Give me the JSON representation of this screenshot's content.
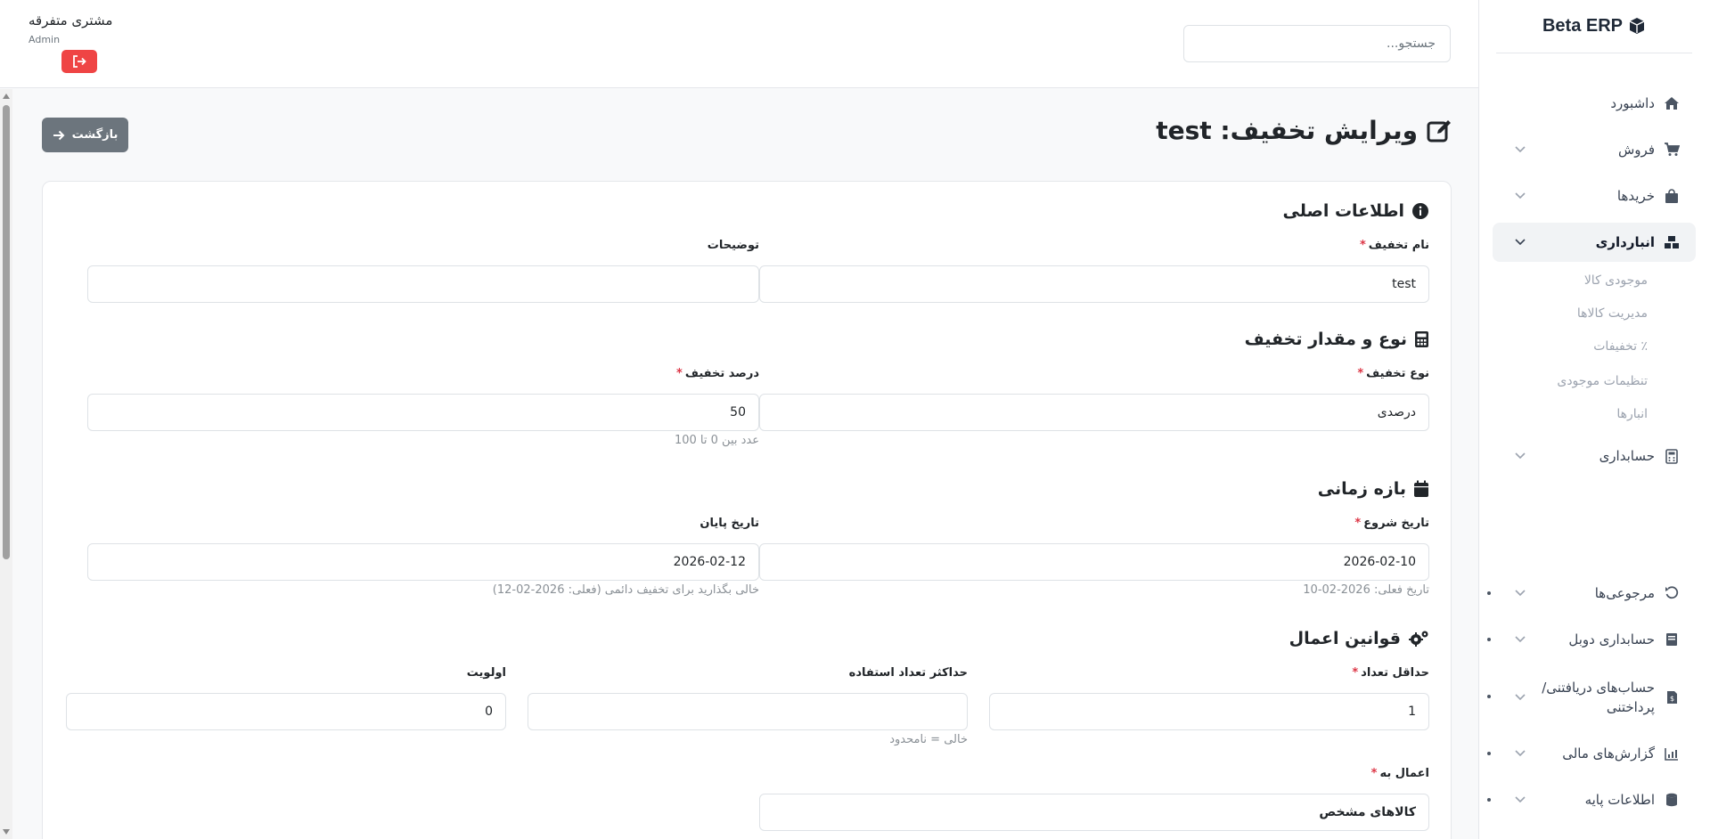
{
  "sidebar": {
    "brand": "Beta ERP",
    "items": [
      {
        "label": "داشبورد"
      },
      {
        "label": "فروش"
      },
      {
        "label": "خریدها"
      },
      {
        "label": "انبارداری"
      },
      {
        "label": "حسابداری"
      },
      {
        "label": "مرجوعی‌ها"
      },
      {
        "label": "حسابداری دوبل"
      },
      {
        "label": "حساب‌های دریافتنی/پرداختنی"
      },
      {
        "label": "گزارش‌های مالی"
      },
      {
        "label": "اطلاعات پایه"
      }
    ],
    "inventory_sub": [
      {
        "label": "موجودی کالا"
      },
      {
        "label": "مدیریت کالاها"
      },
      {
        "label": "٪ تخفیفات"
      },
      {
        "label": "تنظیمات موجودی"
      },
      {
        "label": "انبارها"
      }
    ]
  },
  "header": {
    "search_placeholder": "جستجو...",
    "user_name": "مشتری متفرقه",
    "user_role": "Admin"
  },
  "page": {
    "title": "ویرایش تخفیف: test",
    "back_label": "بازگشت"
  },
  "form": {
    "basic": {
      "title": "اطلاعات اصلی",
      "name_label": "نام تخفیف",
      "name_value": "test",
      "desc_label": "توضیحات",
      "desc_value": ""
    },
    "type": {
      "title": "نوع و مقدار تخفیف",
      "type_label": "نوع تخفیف",
      "type_value": "درصدی",
      "percent_label": "درصد تخفیف",
      "percent_value": "50",
      "percent_hint": "عدد بین 0 تا 100"
    },
    "period": {
      "title": "بازه زمانی",
      "start_label": "تاریخ شروع",
      "start_value": "2026-02-10",
      "start_hint": "تاریخ فعلی: 2026-02-10",
      "end_label": "تاریخ پایان",
      "end_value": "2026-02-12",
      "end_hint": "خالی بگذارید برای تخفیف دائمی (فعلی: 2026-02-12)"
    },
    "rules": {
      "title": "قوانین اعمال",
      "min_qty_label": "حداقل تعداد",
      "min_qty_value": "1",
      "max_usage_label": "حداکثر تعداد استفاده",
      "max_usage_value": "",
      "max_usage_hint": "خالی = نامحدود",
      "priority_label": "اولویت",
      "priority_value": "0",
      "apply_to_label": "اعمال به",
      "apply_to_value": "کالاهای مشخص"
    },
    "required_mark": "*"
  },
  "colors": {
    "danger": "#ef4444",
    "secondary": "#6c757d",
    "required": "#dc3545"
  }
}
